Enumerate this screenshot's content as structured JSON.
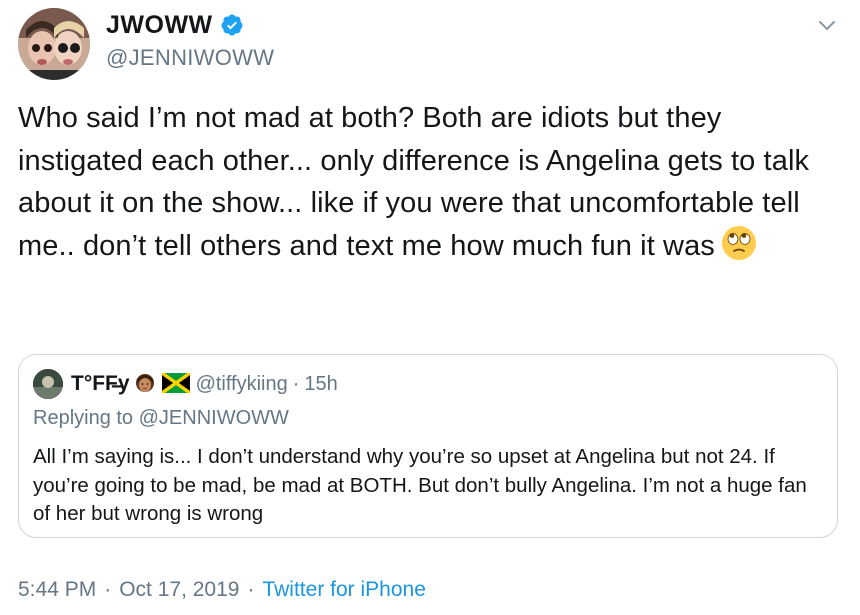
{
  "author": {
    "display_name": "JWOWW",
    "handle": "@JENNIWOWW",
    "verified": true
  },
  "tweet": {
    "text": "Who said I’m not mad at both? Both are idiots but they instigated each other... only difference is Angelina gets to talk about it on the show... like if you were that uncomfortable tell me.. don’t tell others and text me how much fun it was",
    "emoji": "face-with-rolling-eyes"
  },
  "quoted_tweet": {
    "display_name": "T°FF̶y",
    "emojis": [
      "woman-emoji",
      "jamaica-flag-emoji"
    ],
    "handle": "@tiffykiing",
    "dot": "·",
    "time": "15h",
    "replying_prefix": "Replying to ",
    "replying_to": "@JENNIWOWW",
    "text": "All I’m saying is... I don’t understand why you’re so upset at Angelina but not 24. If you’re going to be mad, be mad at BOTH. But don’t bully Angelina. I’m not a huge fan of her but wrong is wrong"
  },
  "meta": {
    "time": "5:44 PM",
    "sep1": "·",
    "date": "Oct 17, 2019",
    "sep2": "·",
    "source": "Twitter for iPhone"
  },
  "colors": {
    "text": "#14171a",
    "secondary": "#657786",
    "link": "#1b95e0",
    "border": "#ccd6dd",
    "verified": "#1da1f2"
  }
}
